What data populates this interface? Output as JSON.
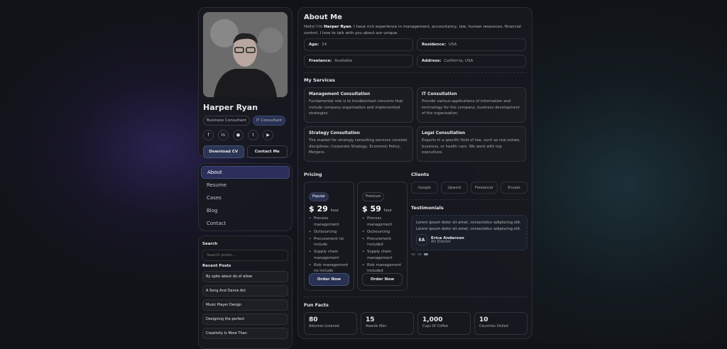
{
  "profile": {
    "name": "Harper Ryan",
    "tags": [
      "Business Consultant",
      "IT Consultant"
    ],
    "socials": [
      "facebook-icon",
      "linkedin-icon",
      "whatsapp-icon",
      "twitter-icon",
      "youtube-icon"
    ],
    "download_label": "Download CV",
    "contact_label": "Contact Me"
  },
  "nav": [
    "About",
    "Resume",
    "Cases",
    "Blog",
    "Contact"
  ],
  "blog": {
    "search_title": "Search",
    "search_placeholder": "Search posts...",
    "recent_title": "Recent Posts",
    "posts": [
      "By spite about do of allow",
      "A Song And Dance Act",
      "Music Player Design",
      "Designing the perfect",
      "Creativity Is More Than"
    ]
  },
  "about": {
    "title": "About Me",
    "intro_pre": "Hello! I'm ",
    "intro_name": "Harper Ryan",
    "intro_post": ". I have rich experience in management, accountancy, law, human resources, financial control. I love to talk with you about our unique.",
    "info": [
      {
        "k": "Age:",
        "v": "24"
      },
      {
        "k": "Residence:",
        "v": "USA"
      },
      {
        "k": "Freelance:",
        "v": "Available"
      },
      {
        "k": "Address:",
        "v": "California, USA"
      }
    ]
  },
  "services": {
    "title": "My Services",
    "items": [
      {
        "t": "Management Consultation",
        "d": "Fundamental role is to troubleshoot concerns that include company organisation and implemented strategies."
      },
      {
        "t": "IT Consultation",
        "d": "Provide various applications of information and technology for the company, business development of the organisation."
      },
      {
        "t": "Strategy Consultation",
        "d": "The market for strategy consulting services consists disciplines: Corporate Strategy, Economic Policy, Mergers."
      },
      {
        "t": "Legal Consultation",
        "d": "Experts in a specific field of law, such as real estate, business, or health care. We work with top executives."
      }
    ]
  },
  "pricing": {
    "title": "Pricing",
    "plans": [
      {
        "badge": "Popular",
        "price": "$ 29",
        "unit": "hour",
        "features": [
          "Process management",
          "Outsourcing",
          "Procurement no include",
          "Supply chain management",
          "Risk management no include"
        ],
        "cta": "Order Now"
      },
      {
        "badge": "Premium",
        "price": "$ 59",
        "unit": "hour",
        "features": [
          "Process management",
          "Outsourcing",
          "Procurement included",
          "Supply chain management",
          "Risk management included"
        ],
        "cta": "Order Now"
      }
    ]
  },
  "clients": {
    "title": "Clients",
    "items": [
      "Google",
      "Upwork",
      "Freelancer",
      "Envato"
    ]
  },
  "testimonials": {
    "title": "Testimonials",
    "text": "Lorem ipsum dolor sit amet, consectetur adipiscing elit. Lorem ipsum dolor sit amet, consectetur adipiscing elit.",
    "initials": "EA",
    "name": "Erica Anderson",
    "role": "Art Director"
  },
  "funfacts": {
    "title": "Fun Facts",
    "items": [
      {
        "n": "80",
        "l": "Albumes Listened"
      },
      {
        "n": "15",
        "l": "Awards Won"
      },
      {
        "n": "1,000",
        "l": "Cups Of Coffee"
      },
      {
        "n": "10",
        "l": "Countries Visited"
      }
    ]
  }
}
